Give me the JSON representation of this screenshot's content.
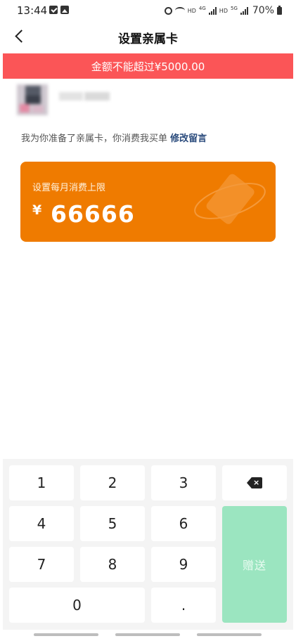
{
  "status_bar": {
    "time": "13:44",
    "battery": "70%",
    "icons": [
      "notification-check-icon",
      "notification-image-icon",
      "alarm-icon",
      "wifi-icon",
      "hd-signal-icon",
      "5g-signal-icon",
      "battery-icon"
    ],
    "hd_label_1": "HD",
    "hd_label_2": "HD",
    "net_4g": "4G",
    "net_5g": "5G"
  },
  "header": {
    "title": "设置亲属卡"
  },
  "alert": {
    "text": "金额不能超过¥5000.00",
    "color": "#fb5557"
  },
  "message": {
    "text": "我为你准备了亲属卡，你消费我买单",
    "edit_link": "修改留言"
  },
  "card": {
    "label": "设置每月消费上限",
    "currency": "¥",
    "amount": "66666",
    "color": "#ef7b00"
  },
  "keypad": {
    "keys": [
      "1",
      "2",
      "3",
      "4",
      "5",
      "6",
      "7",
      "8",
      "9",
      "0",
      "."
    ],
    "backspace_icon": "backspace-icon",
    "confirm_label": "赠送",
    "confirm_color": "#9be5c0"
  }
}
